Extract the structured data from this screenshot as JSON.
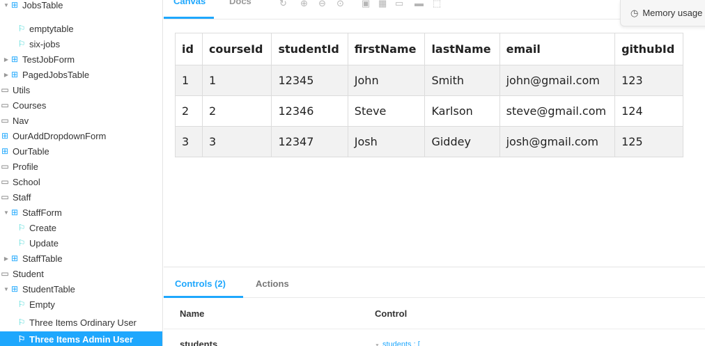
{
  "sidebar": {
    "items": [
      {
        "label": "JobsTable",
        "kind": "component",
        "expanded": true
      },
      {
        "label": "emptytable",
        "kind": "story"
      },
      {
        "label": "six-jobs",
        "kind": "story"
      },
      {
        "label": "TestJobForm",
        "kind": "component",
        "expanded": false
      },
      {
        "label": "PagedJobsTable",
        "kind": "component",
        "expanded": false
      },
      {
        "label": "Utils",
        "kind": "folder"
      },
      {
        "label": "Courses",
        "kind": "folder"
      },
      {
        "label": "Nav",
        "kind": "folder"
      },
      {
        "label": "OurAddDropdownForm",
        "kind": "component"
      },
      {
        "label": "OurTable",
        "kind": "component"
      },
      {
        "label": "Profile",
        "kind": "folder"
      },
      {
        "label": "School",
        "kind": "folder"
      },
      {
        "label": "Staff",
        "kind": "folder"
      },
      {
        "label": "StaffForm",
        "kind": "component",
        "expanded": true
      },
      {
        "label": "Create",
        "kind": "story"
      },
      {
        "label": "Update",
        "kind": "story"
      },
      {
        "label": "StaffTable",
        "kind": "component",
        "expanded": false
      },
      {
        "label": "Student",
        "kind": "folder"
      },
      {
        "label": "StudentTable",
        "kind": "component",
        "expanded": true
      },
      {
        "label": "Empty",
        "kind": "story"
      },
      {
        "label": "Three Items Ordinary User",
        "kind": "story"
      },
      {
        "label": "Three Items Admin User",
        "kind": "story",
        "selected": true
      }
    ]
  },
  "toolbar": {
    "tabs": [
      {
        "label": "Canvas",
        "active": true
      },
      {
        "label": "Docs",
        "active": false
      }
    ],
    "icons": [
      "reload-icon",
      "zoom-in-icon",
      "zoom-out-icon",
      "zoom-reset-icon",
      "background-icon",
      "grid-icon",
      "viewport-icon",
      "measure-icon",
      "outline-icon"
    ]
  },
  "memory": {
    "label": "Memory usage"
  },
  "table": {
    "headers": [
      "id",
      "courseId",
      "studentId",
      "firstName",
      "lastName",
      "email",
      "githubId"
    ],
    "rows": [
      [
        "1",
        "1",
        "12345",
        "John",
        "Smith",
        "john@gmail.com",
        "123"
      ],
      [
        "2",
        "2",
        "12346",
        "Steve",
        "Karlson",
        "steve@gmail.com",
        "124"
      ],
      [
        "3",
        "3",
        "12347",
        "Josh",
        "Giddey",
        "josh@gmail.com",
        "125"
      ]
    ]
  },
  "addon": {
    "tabs": [
      {
        "label": "Controls (2)",
        "active": true
      },
      {
        "label": "Actions",
        "active": false
      }
    ],
    "columns": {
      "name": "Name",
      "control": "Control"
    },
    "rows": [
      {
        "name": "students",
        "control": "students : ["
      }
    ]
  },
  "colors": {
    "accent": "#1ea7fd",
    "story": "#37d5d3"
  }
}
